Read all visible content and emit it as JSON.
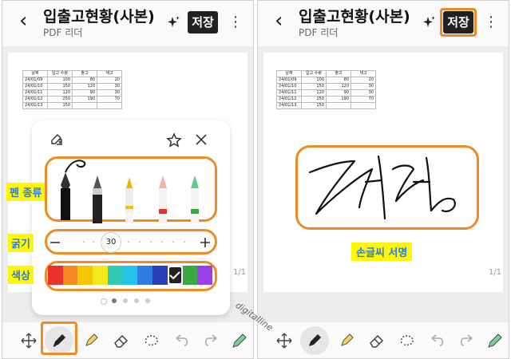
{
  "header": {
    "title": "입출고현황(사본)",
    "subtitle": "PDF 리더",
    "save_label": "저장"
  },
  "sheet": {
    "columns": [
      "날짜",
      "입고 수량",
      "출고",
      "재고"
    ],
    "rows": [
      [
        "24/01/09",
        "100",
        "80",
        "20"
      ],
      [
        "24/01/10",
        "150",
        "120",
        "30"
      ],
      [
        "24/01/11",
        "120",
        "90",
        "30"
      ],
      [
        "24/01/12",
        "250",
        "190",
        "70"
      ],
      [
        "24/01/13",
        "150",
        "",
        ""
      ]
    ]
  },
  "page_indicator": "1/1",
  "pen_panel": {
    "thickness_value": "30",
    "colors": [
      "#e8322d",
      "#f58a1f",
      "#f6c700",
      "#f5e81c",
      "#33c9b5",
      "#24c3e8",
      "#2f7de0",
      "#2a3fb8",
      "#222222",
      "#3aa845",
      "#9b3fe8"
    ],
    "selected_color_index": 8,
    "pager_count": 5,
    "pager_active": 1
  },
  "labels": {
    "pen_type": "펜 종류",
    "thickness": "굵기",
    "color": "색상",
    "signature": "손글씨 서명"
  },
  "watermark": "digitalline",
  "toolbar": {
    "icons": [
      "move-icon",
      "pen-icon",
      "highlighter-icon",
      "eraser-icon",
      "lasso-icon",
      "undo-icon",
      "redo-icon",
      "pencil-color-icon"
    ]
  }
}
